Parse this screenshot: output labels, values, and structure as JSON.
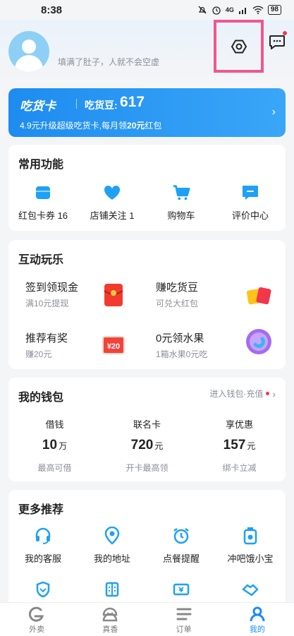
{
  "status": {
    "time": "8:38",
    "battery": "98",
    "network": "4G"
  },
  "header": {
    "slogan": "填满了肚子，人就不会空虚"
  },
  "food_card": {
    "title": "吃货卡",
    "beans_label": "吃货豆:",
    "beans_value": "617",
    "promo_prefix": "4.9元升级超级吃货卡,每月领",
    "promo_amount": "20元",
    "promo_suffix": "红包"
  },
  "common": {
    "title": "常用功能",
    "items": [
      {
        "label": "红包卡券 16",
        "icon": "coupon-icon"
      },
      {
        "label": "店铺关注 1",
        "icon": "heart-icon"
      },
      {
        "label": "购物车",
        "icon": "cart-icon"
      },
      {
        "label": "评价中心",
        "icon": "review-icon"
      }
    ]
  },
  "fun": {
    "title": "互动玩乐",
    "items": [
      {
        "title": "签到领现金",
        "sub": "满10元提现",
        "icon": "red-envelope-icon"
      },
      {
        "title": "赚吃货豆",
        "sub": "可兑大红包",
        "icon": "gift-icon"
      },
      {
        "title": "推荐有奖",
        "sub": "赚20元",
        "icon": "reward-20-icon",
        "badge": "¥20"
      },
      {
        "title": "0元领水果",
        "sub": "1箱水果0元吃",
        "icon": "fruit-icon"
      }
    ]
  },
  "wallet": {
    "title": "我的钱包",
    "link": "进入钱包·充值",
    "cols": [
      {
        "label": "借钱",
        "value": "10",
        "unit": "万",
        "sub": "最高可借"
      },
      {
        "label": "联名卡",
        "value": "720",
        "unit": "元",
        "sub": "开卡最高领"
      },
      {
        "label": "享优惠",
        "value": "157",
        "unit": "元",
        "sub": "绑卡立减"
      }
    ]
  },
  "more": {
    "title": "更多推荐",
    "items": [
      {
        "label": "我的客服",
        "icon": "headset-icon"
      },
      {
        "label": "我的地址",
        "icon": "location-icon"
      },
      {
        "label": "点餐提醒",
        "icon": "alarm-icon"
      },
      {
        "label": "冲吧饿小宝",
        "icon": "bottle-icon"
      }
    ],
    "row2_icons": [
      "shield-icon",
      "store-icon",
      "ticket-icon",
      "handshake-icon"
    ]
  },
  "tabs": [
    {
      "label": "外卖",
      "icon": "takeout-icon"
    },
    {
      "label": "真香",
      "icon": "face-icon"
    },
    {
      "label": "订单",
      "icon": "list-icon"
    },
    {
      "label": "我的",
      "icon": "profile-icon",
      "active": true
    }
  ],
  "colors": {
    "accent": "#1a8cf5",
    "highlight_box": "#f0578f",
    "red": "#f2364b"
  }
}
